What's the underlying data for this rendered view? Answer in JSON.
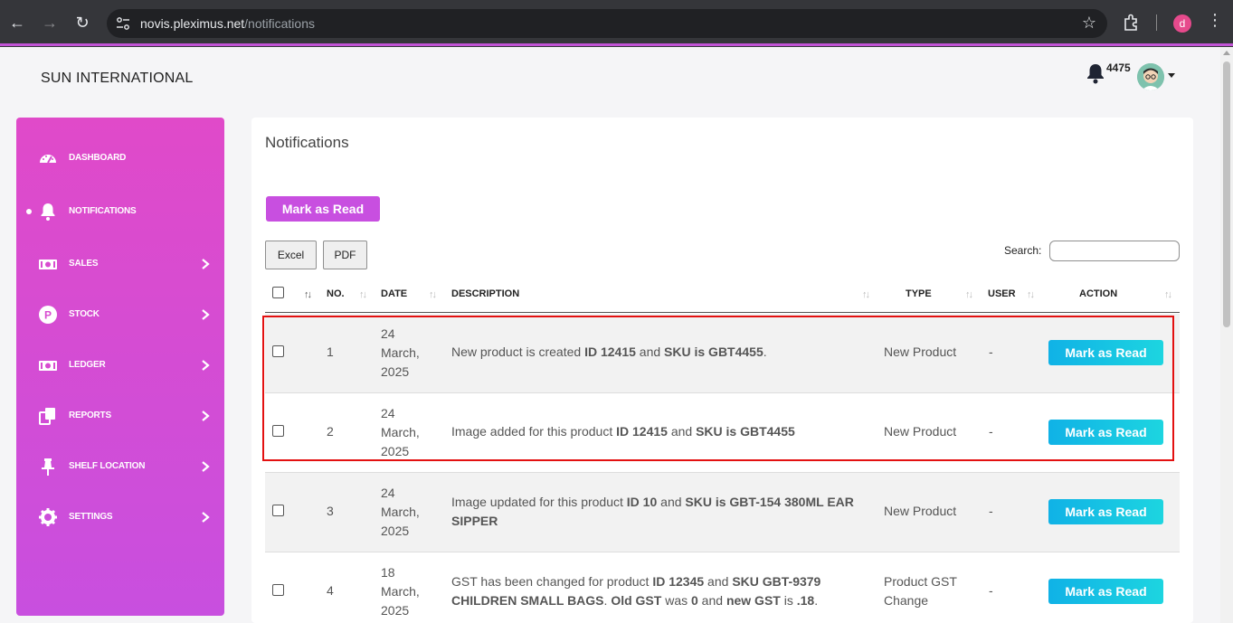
{
  "browser": {
    "url_host": "novis.pleximus.net",
    "url_path": "/notifications",
    "profile_initial": "d"
  },
  "header": {
    "brand": "SUN INTERNATIONAL",
    "notification_count": "4475"
  },
  "sidebar": {
    "items": [
      {
        "label": "DASHBOARD",
        "icon": "speedometer-icon"
      },
      {
        "label": "NOTIFICATIONS",
        "icon": "bell-icon",
        "active": true
      },
      {
        "label": "SALES",
        "icon": "money-icon"
      },
      {
        "label": "STOCK",
        "icon": "p-circle-icon"
      },
      {
        "label": "LEDGER",
        "icon": "money-icon"
      },
      {
        "label": "REPORTS",
        "icon": "documents-icon"
      },
      {
        "label": "SHELF LOCATION",
        "icon": "pin-icon"
      },
      {
        "label": "SETTINGS",
        "icon": "gear-icon"
      }
    ]
  },
  "main": {
    "title": "Notifications",
    "mark_all_label": "Mark as Read",
    "export_buttons": [
      "Excel",
      "PDF"
    ],
    "search_label": "Search:",
    "search_value": "",
    "columns": [
      "NO.",
      "DATE",
      "DESCRIPTION",
      "TYPE",
      "USER",
      "ACTION"
    ],
    "rows": [
      {
        "no": "1",
        "date": [
          "24",
          "March,",
          "2025"
        ],
        "type": "New Product",
        "user": "-",
        "action": "Mark as Read",
        "desc": [
          {
            "t": "New product is created ",
            "b": false
          },
          {
            "t": "ID 12415",
            "b": true
          },
          {
            "t": " and ",
            "b": false
          },
          {
            "t": "SKU is GBT4455",
            "b": true
          },
          {
            "t": ".",
            "b": false
          }
        ]
      },
      {
        "no": "2",
        "date": [
          "24",
          "March,",
          "2025"
        ],
        "type": "New Product",
        "user": "-",
        "action": "Mark as Read",
        "desc": [
          {
            "t": "Image added for this product ",
            "b": false
          },
          {
            "t": "ID 12415",
            "b": true
          },
          {
            "t": " and ",
            "b": false
          },
          {
            "t": "SKU is GBT4455",
            "b": true
          }
        ]
      },
      {
        "no": "3",
        "date": [
          "24",
          "March,",
          "2025"
        ],
        "type": "New Product",
        "user": "-",
        "action": "Mark as Read",
        "desc": [
          {
            "t": "Image updated for this product ",
            "b": false
          },
          {
            "t": "ID 10",
            "b": true
          },
          {
            "t": " and ",
            "b": false
          },
          {
            "t": "SKU is GBT-154 380ML EAR SIPPER",
            "b": true
          }
        ]
      },
      {
        "no": "4",
        "date": [
          "18",
          "March,",
          "2025"
        ],
        "type": "Product GST Change",
        "user": "-",
        "action": "Mark as Read",
        "desc": [
          {
            "t": "GST has been changed for product ",
            "b": false
          },
          {
            "t": "ID 12345",
            "b": true
          },
          {
            "t": " and ",
            "b": false
          },
          {
            "t": "SKU GBT-9379 CHILDREN SMALL BAGS",
            "b": true
          },
          {
            "t": ". ",
            "b": false
          },
          {
            "t": "Old GST",
            "b": true
          },
          {
            "t": " was ",
            "b": false
          },
          {
            "t": "0",
            "b": true
          },
          {
            "t": " and ",
            "b": false
          },
          {
            "t": "new GST",
            "b": true
          },
          {
            "t": " is ",
            "b": false
          },
          {
            "t": ".18",
            "b": true
          },
          {
            "t": ".",
            "b": false
          }
        ]
      }
    ]
  },
  "colors": {
    "sidebar_top": "#e04ac9",
    "sidebar_bottom": "#c84fdf",
    "mark_all_button": "#c84fe0",
    "mark_row_button": "#10b2e6",
    "highlight_border": "#e31111"
  }
}
